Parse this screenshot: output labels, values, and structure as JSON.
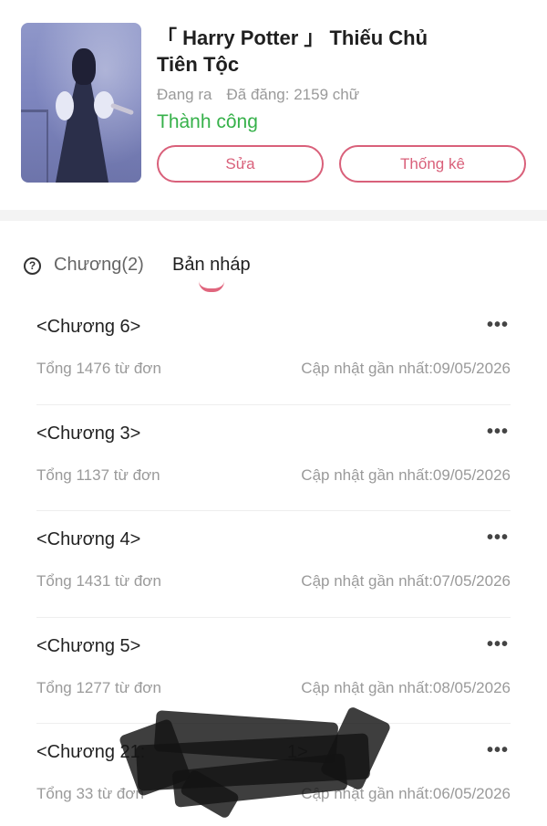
{
  "book": {
    "title": "「 Harry Potter 」 Thiếu Chủ Tiên Tộc",
    "state": "Đang ra",
    "posted": "Đã đăng: 2159 chữ",
    "status": "Thành công"
  },
  "actions": {
    "edit_label": "Sửa",
    "stats_label": "Thống kê"
  },
  "tabs": {
    "chapters": "Chương(2)",
    "drafts": "Bản nháp",
    "help_symbol": "?"
  },
  "drafts": [
    {
      "title": "<Chương 6>",
      "words": "Tổng 1476 từ đơn",
      "updated": "Cập nhật gần nhất:09/05/2026"
    },
    {
      "title": "<Chương 3>",
      "words": "Tổng 1137 từ đơn",
      "updated": "Cập nhật gần nhất:09/05/2026"
    },
    {
      "title": "<Chương 4>",
      "words": "Tổng 1431 từ đơn",
      "updated": "Cập nhật gần nhất:07/05/2026"
    },
    {
      "title": "<Chương 5>",
      "words": "Tổng 1277 từ đơn",
      "updated": "Cập nhật gần nhất:08/05/2026"
    },
    {
      "title": "<Chương 21:                            1>",
      "words": "Tổng 33 từ đơn",
      "updated": "Cập nhật gần nhất:06/05/2026"
    }
  ],
  "more_symbol": "•••",
  "colors": {
    "accent": "#d9607a",
    "success": "#36b14a",
    "muted": "#9a9a9a"
  },
  "icons": {
    "help": "help-circle-icon",
    "more": "more-horizontal-icon"
  }
}
